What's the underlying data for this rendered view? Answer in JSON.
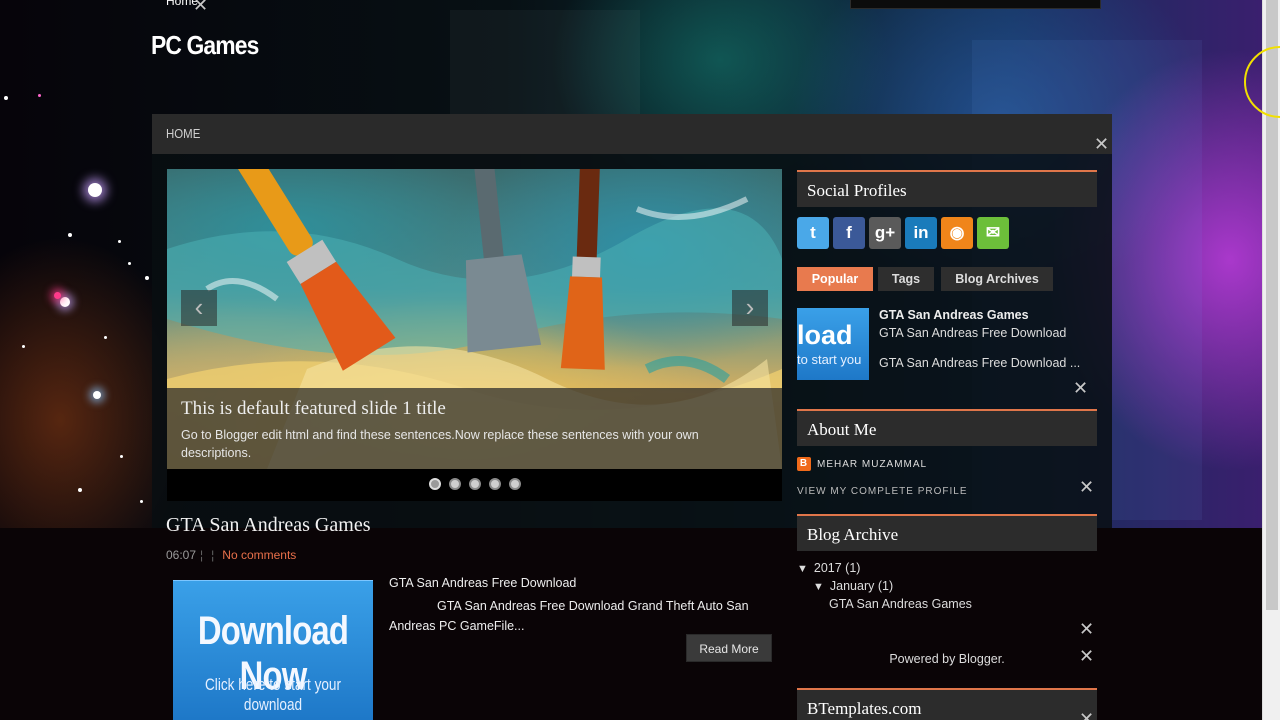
{
  "colors": {
    "accent": "#e87a4e",
    "menubar": "#2a2a2a",
    "widget_head": "#2c2c2c"
  },
  "top": {
    "home_label": "Home"
  },
  "site": {
    "title": "PC Games"
  },
  "menu": {
    "home": "HOME"
  },
  "slider": {
    "title": "This is default featured slide 1 title",
    "description": "Go to Blogger edit html and find these sentences.Now replace these sentences with your own descriptions.",
    "prev_icon": "‹",
    "next_icon": "›",
    "dot_count": 5,
    "active_dot": 1
  },
  "post": {
    "title": "GTA San Andreas Games",
    "time": "06:07",
    "comments": "No comments",
    "thumb_big": "Download Now",
    "thumb_small": "Click here to start your download",
    "excerpt_head": "GTA San Andreas Free Download",
    "excerpt": "GTA San Andreas Free Download Grand Theft Auto San Andreas PC GameFile...",
    "read_more": "Read More"
  },
  "sidebar": {
    "social_title": "Social Profiles",
    "social_icons": [
      {
        "name": "twitter-icon",
        "glyph": "t",
        "color": "#4aa8e8"
      },
      {
        "name": "facebook-icon",
        "glyph": "f",
        "color": "#3b5998"
      },
      {
        "name": "google-plus-icon",
        "glyph": "g+",
        "color": "#5a5a5a"
      },
      {
        "name": "linkedin-icon",
        "glyph": "in",
        "color": "#1a7bbb"
      },
      {
        "name": "rss-icon",
        "glyph": "◉",
        "color": "#f0851a"
      },
      {
        "name": "email-icon",
        "glyph": "✉",
        "color": "#6cbf3a"
      }
    ],
    "tabs": [
      "Popular",
      "Tags",
      "Blog Archives"
    ],
    "popular": {
      "thumb_a": "load",
      "thumb_b": "to start you",
      "title": "GTA San Andreas Games",
      "line1": "GTA San Andreas Free Download",
      "line2": "GTA San Andreas Free Download ..."
    },
    "about_title": "About Me",
    "about_name": "MEHAR MUZAMMAL",
    "about_link": "VIEW MY COMPLETE PROFILE",
    "archive_title": "Blog Archive",
    "archive_year": "2017 (1)",
    "archive_month": "January (1)",
    "archive_post": "GTA San Andreas Games",
    "powered": "Powered by Blogger.",
    "btemplates_title": "BTemplates.com"
  }
}
